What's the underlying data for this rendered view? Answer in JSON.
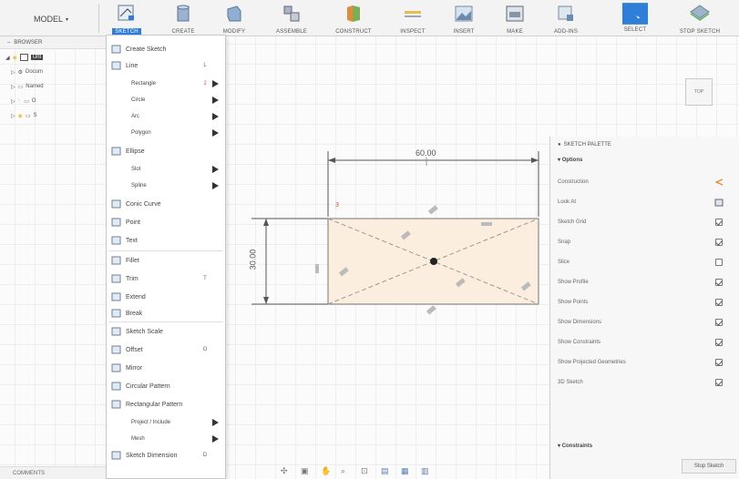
{
  "toolbar": {
    "model": "MODEL",
    "tools": [
      {
        "label": "SKETCH",
        "icon": "sketch-icon",
        "active": true
      },
      {
        "label": "CREATE",
        "icon": "create-icon"
      },
      {
        "label": "MODIFY",
        "icon": "modify-icon"
      },
      {
        "label": "ASSEMBLE",
        "icon": "assemble-icon"
      },
      {
        "label": "CONSTRUCT",
        "icon": "construct-icon"
      },
      {
        "label": "INSPECT",
        "icon": "inspect-icon"
      },
      {
        "label": "INSERT",
        "icon": "insert-icon"
      },
      {
        "label": "MAKE",
        "icon": "make-icon"
      },
      {
        "label": "ADD-INS",
        "icon": "addins-icon"
      },
      {
        "label": "SELECT",
        "icon": "select-icon"
      },
      {
        "label": "STOP SKETCH",
        "icon": "stop-sketch-icon"
      }
    ]
  },
  "browser": {
    "title": "BROWSER",
    "items": [
      "Unt",
      "Docum",
      "Named",
      "O",
      "S"
    ]
  },
  "comments": {
    "label": "COMMENTS"
  },
  "sketch_menu": {
    "items": [
      {
        "label": "Create Sketch",
        "icon": "create-sketch-icon"
      },
      {
        "label": "Line",
        "key": "L",
        "icon": "line-icon"
      },
      {
        "label": "Rectangle",
        "key": "2",
        "arrow": true,
        "indent": true
      },
      {
        "label": "Circle",
        "arrow": true,
        "indent": true
      },
      {
        "label": "Arc",
        "arrow": true,
        "indent": true
      },
      {
        "label": "Polygon",
        "arrow": true,
        "indent": true
      },
      {
        "label": "Ellipse",
        "icon": "ellipse-icon"
      },
      {
        "label": "Slot",
        "arrow": true,
        "indent": true
      },
      {
        "label": "Spline",
        "arrow": true,
        "indent": true
      },
      {
        "label": "Conic Curve",
        "icon": "conic-curve-icon"
      },
      {
        "label": "Point",
        "icon": "point-icon"
      },
      {
        "label": "Text",
        "icon": "text-icon"
      },
      {
        "label": "Fillet",
        "icon": "fillet-icon"
      },
      {
        "label": "Trim",
        "key": "T",
        "icon": "trim-icon"
      },
      {
        "label": "Extend",
        "icon": "extend-icon"
      },
      {
        "label": "Break",
        "icon": "break-icon"
      },
      {
        "label": "Sketch Scale",
        "icon": "sketch-scale-icon"
      },
      {
        "label": "Offset",
        "key": "O",
        "icon": "offset-icon"
      },
      {
        "label": "Mirror",
        "icon": "mirror-icon"
      },
      {
        "label": "Circular Pattern",
        "icon": "circular-pattern-icon"
      },
      {
        "label": "Rectangular Pattern",
        "icon": "rectangular-pattern-icon"
      },
      {
        "label": "Project / Include",
        "arrow": true,
        "indent": true
      },
      {
        "label": "Mesh",
        "arrow": true,
        "indent": true
      },
      {
        "label": "Sketch Dimension",
        "key": "D",
        "icon": "sketch-dimension-icon"
      }
    ]
  },
  "canvas": {
    "dim_horizontal": "60.00",
    "dim_vertical": "30.00",
    "annotation_marker": "3",
    "rect_fill": "#fbeede",
    "accent_red": "#e04848"
  },
  "palette": {
    "title": "SKETCH PALETTE",
    "options_header": "Options",
    "options": [
      {
        "label": "Construction",
        "control": "construction-icon"
      },
      {
        "label": "Look At",
        "control": "look-at-icon"
      },
      {
        "label": "Sketch Grid",
        "checked": true
      },
      {
        "label": "Snap",
        "checked": true
      },
      {
        "label": "Slice",
        "checked": false
      },
      {
        "label": "Show Profile",
        "checked": true
      },
      {
        "label": "Show Points",
        "checked": true
      },
      {
        "label": "Show Dimensions",
        "checked": true
      },
      {
        "label": "Show Constraints",
        "checked": true
      },
      {
        "label": "Show Projected Geometries",
        "checked": true
      },
      {
        "label": "3D Sketch",
        "checked": true
      }
    ],
    "constraints_header": "Constraints",
    "stop_label": "Stop Sketch"
  },
  "viewcube": {
    "label": "TOP"
  },
  "colors": {
    "accent": "#2f7ed8",
    "menu_bg": "#ffffff",
    "palette_bg": "#f7f7f7"
  }
}
